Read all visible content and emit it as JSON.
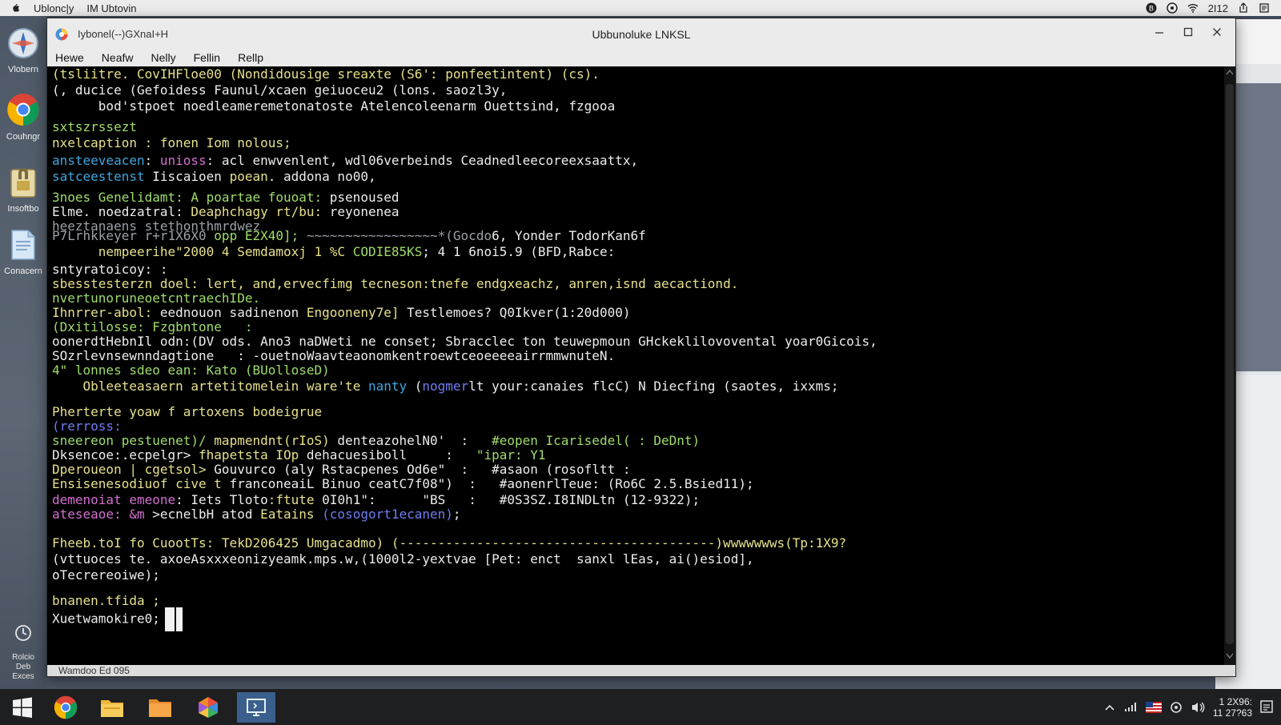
{
  "topbar": {
    "left": [
      "Ublonc|y",
      "IM Ubtovin"
    ],
    "clock": "2I12",
    "icons": [
      "apple-icon",
      "shield-icon",
      "wifi-icon",
      "share-icon",
      "notes-icon"
    ]
  },
  "dock": {
    "items": [
      {
        "label": "Vlobern",
        "icon": "compass-icon"
      },
      {
        "label": "Couhngr",
        "icon": "chrome-icon"
      },
      {
        "label": "Insoftbo",
        "icon": "installer-icon"
      },
      {
        "label": "Conacern",
        "icon": "document-icon"
      }
    ],
    "bottom": {
      "icon": "clock-icon",
      "lines": [
        "Rolcio",
        "Deb",
        "Exces"
      ]
    }
  },
  "window": {
    "tab": "Iybonel(--)GXnaI+H",
    "title": "Ubbunoluke LNKSL",
    "menu": [
      "Hewe",
      "Neafw",
      "Nelly",
      "Fellin",
      "Rellp"
    ],
    "status": "Wamdoo Ed 095"
  },
  "terminal": {
    "lines": [
      [
        {
          "t": "(tsliitre. CovIHFloe00 (Nondidousige sreaxte (S6': ponfeetintent) (cs).",
          "c": "y"
        }
      ],
      [
        {
          "t": "(, ducice (Gefoidess Faunul/xcaen geiuoceu2 (lons. saozl3y,",
          "c": "w"
        }
      ],
      [
        {
          "t": "      bod'stpoet noedleameremetonatoste Atelencoleenarm Ouettsind, fzgooa",
          "c": "w"
        }
      ],
      [
        {
          "t": "sxtszrssezt",
          "c": "g"
        }
      ],
      [
        {
          "t": "nxelcaption : fonen Iom nolous;",
          "c": "y"
        }
      ],
      [
        {
          "t": "ansteeveacen",
          "c": "b"
        },
        {
          "t": ": ",
          "c": "w"
        },
        {
          "t": "unioss",
          "c": "m"
        },
        {
          "t": ": acl enwvenlent, wdl06verbeinds Ceadnedleecoreexsaattx,",
          "c": "w"
        }
      ],
      [
        {
          "t": "satceestenst",
          "c": "b"
        },
        {
          "t": " Iiscaioen ",
          "c": "w"
        },
        {
          "t": "poean",
          "c": "y"
        },
        {
          "t": ". addona no00,",
          "c": "w"
        }
      ],
      [
        {
          "t": "3noes Genelidamt: A poartae fouoat: ",
          "c": "g"
        },
        {
          "t": "psenoused",
          "c": "w"
        }
      ],
      [
        {
          "t": "Elme. noedzatral: ",
          "c": "w"
        },
        {
          "t": "Deaphchagy rt/bu: ",
          "c": "y"
        },
        {
          "t": "reyonenea",
          "c": "w"
        }
      ],
      [
        {
          "t": "heeztanaens stethonthmrdwez",
          "c": "gy"
        }
      ],
      [
        {
          "t": "P7Lrhkkeyer r+r1X6X0 ",
          "c": "gy"
        },
        {
          "t": "opp E2X40]; ",
          "c": "g"
        },
        {
          "t": "~~~~~~~~~~~~~~~~~*(Gocdo",
          "c": "gy"
        },
        {
          "t": "6, Yonder TodorKan6f",
          "c": "w"
        }
      ],
      [
        {
          "t": "      nempeerihe\"2000 4 Semdamoxj 1 %C ",
          "c": "y"
        },
        {
          "t": "CODIE85KS",
          "c": "g"
        },
        {
          "t": "; 4 1 6noi5.9 (BFD,Rabce:",
          "c": "w"
        }
      ],
      [
        {
          "t": "sntyratoicoy: :",
          "c": "w"
        }
      ],
      [
        {
          "t": "sbesstesterzn doel:",
          "c": "y"
        },
        {
          "t": " lert, and,ervecfimg tecneson:tnefe endgxeachz, anren,isnd aecactiond.",
          "c": "y"
        }
      ],
      [
        {
          "t": "nvertunoruneoetcntraechIDe.",
          "c": "g"
        }
      ],
      [
        {
          "t": "Ihnrrer-abol: ",
          "c": "y"
        },
        {
          "t": "eednouon sadinenon ",
          "c": "w"
        },
        {
          "t": "Engooneny7e]",
          "c": "y"
        },
        {
          "t": " Testlemoes? Q0Ikver(1:20d000)",
          "c": "w"
        }
      ],
      [
        {
          "t": "(Dxitilosse: Fzgbntone   :",
          "c": "g"
        }
      ],
      [
        {
          "t": "oonerdtHebnIl odn:(DV ods. Ano3 naDWeti ne conset; Sbracclec ton teuwepmoun GHckeklilovovental yoar0Gicois,",
          "c": "w"
        }
      ],
      [
        {
          "t": "SOzrlevnsewnndagtione   : -ouetnoWaavteaonomkentroewtceoeeeeairrmmwnuteN.",
          "c": "w"
        }
      ],
      [
        {
          "t": "4\" lonnes sdeo ean: Kato (BUolloseD)",
          "c": "g"
        }
      ],
      [
        {
          "t": "    Obleeteasaern artetitomelein ",
          "c": "y"
        },
        {
          "t": "ware'te ",
          "c": "y"
        },
        {
          "t": "nanty",
          "c": "b"
        },
        {
          "t": " (",
          "c": "w"
        },
        {
          "t": "nogmer",
          "c": "bl"
        },
        {
          "t": "lt your:canaies flcC) N Diecfing (saotes, ixxms;",
          "c": "w"
        }
      ],
      [
        {
          "t": "Pherterte yoaw f artoxens bodeigrue",
          "c": "y"
        }
      ],
      [
        {
          "t": "(rerross:",
          "c": "bl"
        }
      ],
      [
        {
          "t": "sneereon pestuenet)/ ",
          "c": "g"
        },
        {
          "t": "mapmendnt(rIoS) ",
          "c": "y"
        },
        {
          "t": "denteazohelN0'  :   ",
          "c": "w"
        },
        {
          "t": "#eopen Icarisedel( : DeDnt)",
          "c": "g"
        }
      ],
      [
        {
          "t": "Dksencoe:.ecpelgr> ",
          "c": "w"
        },
        {
          "t": "fhapetsta IOp ",
          "c": "y"
        },
        {
          "t": "dehacuesiboll  ",
          "c": "w"
        },
        {
          "t": "   :  ",
          "c": "w"
        },
        {
          "t": " \"ipar: Y1",
          "c": "g"
        }
      ],
      [
        {
          "t": "Dperoueon | cgetsol> ",
          "c": "y"
        },
        {
          "t": "Gouvurco (aly Rstacpenes Od6e\"",
          "c": "w"
        },
        {
          "t": "  :  ",
          "c": "w"
        },
        {
          "t": " #asaon (rosofltt :",
          "c": "w"
        }
      ],
      [
        {
          "t": "Ensisenesodiuof cive t ",
          "c": "y"
        },
        {
          "t": "franconeaiL Binuo ceatC7f08\")",
          "c": "w"
        },
        {
          "t": "  :   ",
          "c": "w"
        },
        {
          "t": "#aonenrlTeue: (Ro6C 2.5.Bsied11);",
          "c": "w"
        }
      ],
      [
        {
          "t": "demenoiat emeone",
          "c": "m"
        },
        {
          "t": ": Iets ",
          "c": "w"
        },
        {
          "t": "Tloto",
          "c": "w"
        },
        {
          "t": ":ftute ",
          "c": "y"
        },
        {
          "t": "0I0h1\":      \"BS   :   ",
          "c": "w"
        },
        {
          "t": "#0S3SZ.I8INDLtn (12-9322);",
          "c": "w"
        }
      ],
      [
        {
          "t": "ateseaoe: ",
          "c": "m"
        },
        {
          "t": "&m ",
          "c": "m"
        },
        {
          "t": ">ecnelbH atod ",
          "c": "w"
        },
        {
          "t": "Eatains ",
          "c": "y"
        },
        {
          "t": "(cosogort1ecanen)",
          "c": "bl"
        },
        {
          "t": ";",
          "c": "w"
        }
      ],
      [
        {
          "t": "Fheeb.toI fo CuootTs: TekD206425 Umgacadmo) (-----------------------------------------)wwwwwwws(Tp:1X9?",
          "c": "y"
        }
      ],
      [
        {
          "t": "(vttuoces te. axoeAsxxxeonizyeamk.mps.w,(1000l2-yextvae [Pet: enct  sanxl lEas, ai()esiod],",
          "c": "w"
        }
      ],
      [
        {
          "t": "oTecrereoiwe);",
          "c": "w"
        }
      ],
      [
        {
          "t": "bnanen.tfida ;",
          "c": "y"
        }
      ],
      [
        {
          "t": "Xuetwamokire0;",
          "c": "w"
        }
      ]
    ]
  },
  "taskbar": {
    "apps": [
      "windows-start-icon",
      "chrome-icon",
      "file-explorer-icon",
      "folder-icon",
      "colorful-app-icon",
      "remote-desktop-icon"
    ],
    "clock_time": "1 2X96:",
    "clock_date": "11 27?63",
    "tray": [
      "chevron-up-icon",
      "network-icon",
      "flag-icon",
      "settings-icon",
      "volume-icon"
    ]
  }
}
